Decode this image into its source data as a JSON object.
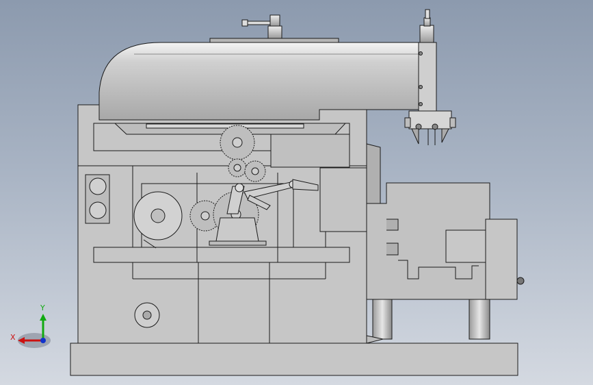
{
  "viewport": {
    "background_top": "#8c9aae",
    "background_bottom": "#d4d9e1",
    "part_fill": "#c6c6c6",
    "part_dark": "#9e9e9e",
    "edge_color": "#1a1a1a"
  },
  "triad": {
    "x_label": "X",
    "y_label": "Y",
    "x_color": "#cc1111",
    "y_color": "#11aa11",
    "z_color": "#1133cc"
  }
}
